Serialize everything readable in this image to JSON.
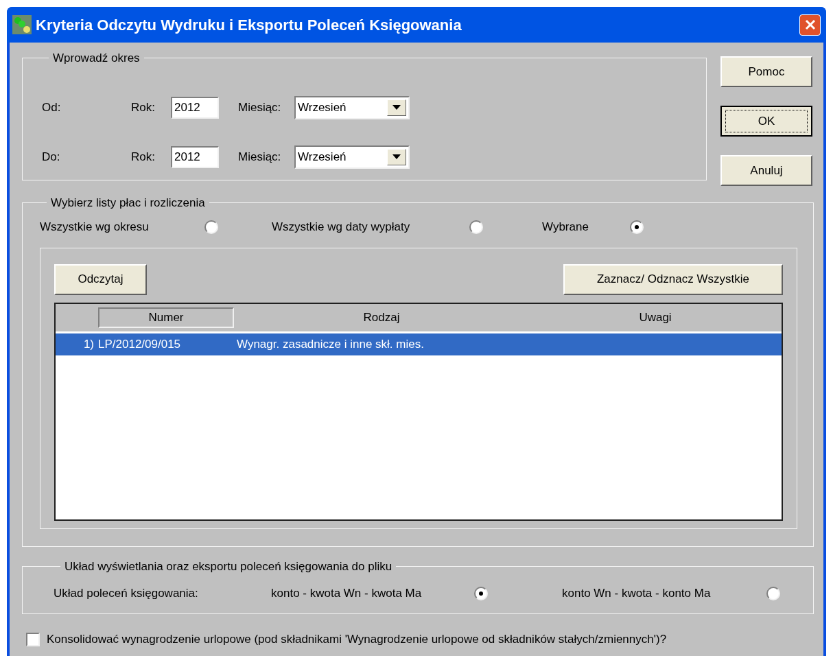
{
  "window": {
    "title": "Kryteria Odczytu Wydruku i Eksportu Poleceń Księgowania"
  },
  "period_group": {
    "legend": "Wprowadź okres",
    "rows": [
      {
        "label": "Od:",
        "year_label": "Rok:",
        "year": "2012",
        "month_label": "Miesiąc:",
        "month": "Wrzesień"
      },
      {
        "label": "Do:",
        "year_label": "Rok:",
        "year": "2012",
        "month_label": "Miesiąc:",
        "month": "Wrzesień"
      }
    ]
  },
  "buttons": [
    {
      "label": "Pomoc",
      "default": false
    },
    {
      "label": "OK",
      "default": true
    },
    {
      "label": "Anuluj",
      "default": false
    }
  ],
  "lists_group": {
    "legend": "Wybierz listy płac i rozliczenia",
    "options": [
      {
        "label": "Wszystkie wg okresu",
        "selected": false
      },
      {
        "label": "Wszystkie wg daty wypłaty",
        "selected": false
      },
      {
        "label": "Wybrane",
        "selected": true
      }
    ],
    "read_button": "Odczytaj",
    "toggle_all_button": "Zaznacz/ Odznacz Wszystkie",
    "table": {
      "columns": [
        "Numer",
        "Rodzaj",
        "Uwagi"
      ],
      "rows": [
        {
          "index": "1)",
          "number": "LP/2012/09/015",
          "type": "Wynagr. zasadnicze i inne skł. mies.",
          "selected": true
        }
      ]
    }
  },
  "layout_group": {
    "legend": "Układ wyświetlania oraz eksportu poleceń księgowania do pliku",
    "label": "Układ poleceń księgowania:",
    "options": [
      {
        "label": "konto - kwota Wn - kwota Ma",
        "selected": true
      },
      {
        "label": "konto Wn - kwota - konto Ma",
        "selected": false
      }
    ]
  },
  "consolidate": {
    "label": "Konsolidować wynagrodzenie urlopowe (pod składnikami 'Wynagrodzenie urlopowe od składników stałych/zmiennych')?",
    "checked": false
  }
}
